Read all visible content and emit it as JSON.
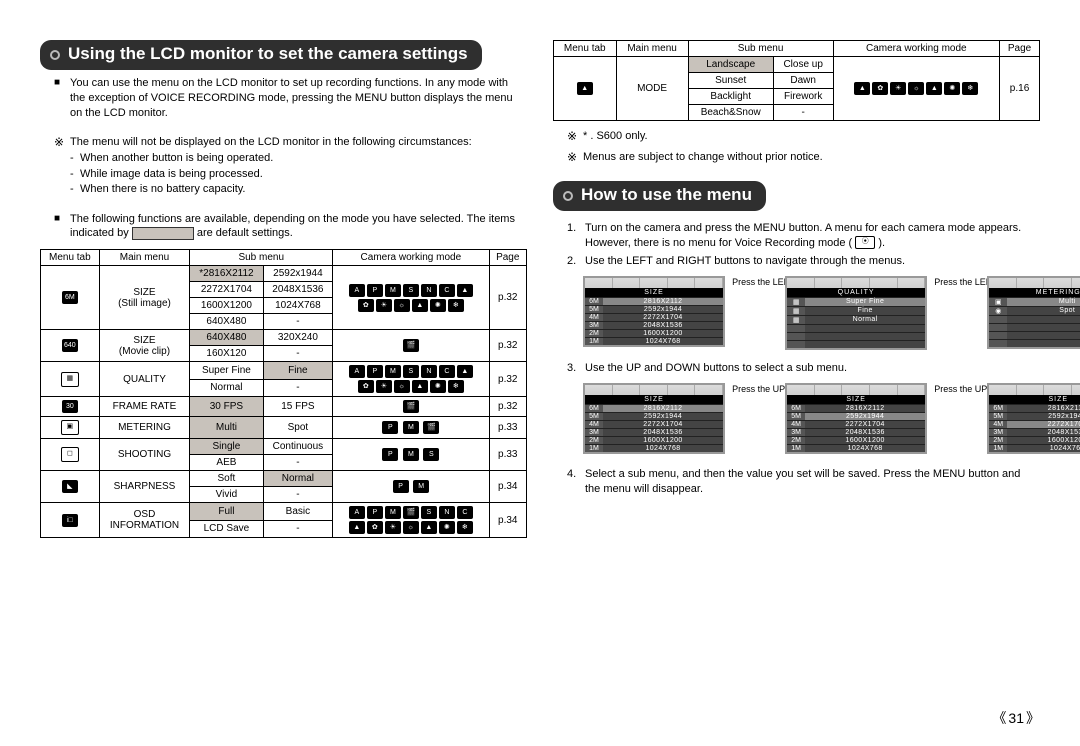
{
  "page_number": "31",
  "left": {
    "banner": "Using the LCD monitor to set the camera settings",
    "intro": "You can use the menu on the LCD monitor to set up recording functions. In any mode with the exception of VOICE RECORDING mode, pressing the MENU button displays the menu on the LCD monitor.",
    "not_displayed_lead": "The menu will not be displayed on the LCD monitor in the following circumstances:",
    "not_displayed_items": [
      "When another button is being operated.",
      "While image data is being processed.",
      "When there is no battery capacity."
    ],
    "functions_lead": "The following functions are available, depending on the mode you have selected. The items indicated by",
    "functions_tail": "are default settings.",
    "table_head": [
      "Menu tab",
      "Main menu",
      "Sub menu",
      "",
      "Camera working mode",
      "Page"
    ],
    "rows": {
      "size_still_label1": "SIZE",
      "size_still_label2": "(Still image)",
      "size_still": [
        [
          "*2816X2112",
          "2592x1944"
        ],
        [
          "2272X1704",
          "2048X1536"
        ],
        [
          "1600X1200",
          "1024X768"
        ],
        [
          "640X480",
          "-"
        ]
      ],
      "size_still_page": "p.32",
      "size_movie_label1": "SIZE",
      "size_movie_label2": "(Movie clip)",
      "size_movie": [
        [
          "640X480",
          "320X240"
        ],
        [
          "160X120",
          "-"
        ]
      ],
      "size_movie_page": "p.32",
      "quality_label": "QUALITY",
      "quality": [
        [
          "Super Fine",
          "Fine"
        ],
        [
          "Normal",
          "-"
        ]
      ],
      "quality_page": "p.32",
      "frame_label": "FRAME RATE",
      "frame": [
        "30 FPS",
        "15 FPS"
      ],
      "frame_page": "p.32",
      "metering_label": "METERING",
      "metering": [
        "Multi",
        "Spot"
      ],
      "metering_page": "p.33",
      "shooting_label": "SHOOTING",
      "shooting": [
        [
          "Single",
          "Continuous"
        ],
        [
          "AEB",
          "-"
        ]
      ],
      "shooting_page": "p.33",
      "sharp_label": "SHARPNESS",
      "sharp": [
        [
          "Soft",
          "Normal"
        ],
        [
          "Vivid",
          "-"
        ]
      ],
      "sharp_page": "p.34",
      "osd_label1": "OSD",
      "osd_label2": "INFORMATION",
      "osd": [
        [
          "Full",
          "Basic"
        ],
        [
          "LCD Save",
          "-"
        ]
      ],
      "osd_page": "p.34"
    }
  },
  "right": {
    "table_head": [
      "Menu tab",
      "Main menu",
      "Sub menu",
      "",
      "Camera working mode",
      "Page"
    ],
    "mode_label": "MODE",
    "mode_rows": [
      [
        "Landscape",
        "Close up"
      ],
      [
        "Sunset",
        "Dawn"
      ],
      [
        "Backlight",
        "Firework"
      ],
      [
        "Beach&Snow",
        "-"
      ]
    ],
    "mode_page": "p.16",
    "note_star": "* . S600 only.",
    "note_change": "Menus are subject to change without prior notice.",
    "banner2": "How to use the menu",
    "step1": "Turn on the camera and press the MENU button. A menu for each camera mode appears. However, there is no menu for Voice Recording mode (",
    "step1_tail": ").",
    "step2": "Use the LEFT and RIGHT buttons to navigate through the menus.",
    "hint_lr": "Press the LEFT or RIGHT button.",
    "step3": "Use the UP and DOWN buttons to select a sub menu.",
    "hint_ud": "Press the UP or DOWN button.",
    "step4": "Select a sub menu, and then the value you set will be saved. Press the MENU button and the menu will disappear.",
    "lcd": {
      "label_size": "SIZE",
      "label_quality": "QUALITY",
      "label_metering": "METERING",
      "size_vals": [
        "2816X2112",
        "2592x1944",
        "2272X1704",
        "2048X1536",
        "1600X1200",
        "1024X768"
      ],
      "size_marks": [
        "6M",
        "5M",
        "4M",
        "3M",
        "2M",
        "1M"
      ],
      "qual_vals": [
        "Super Fine",
        "Fine",
        "Normal"
      ],
      "met_vals": [
        "Multi",
        "Spot"
      ]
    }
  }
}
